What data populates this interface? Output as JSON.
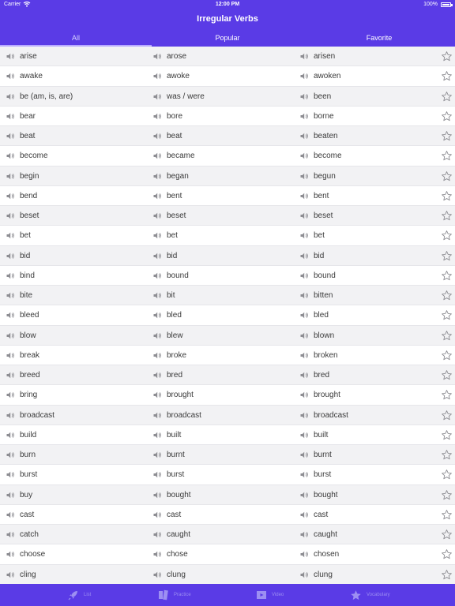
{
  "status_bar": {
    "carrier": "Carrier",
    "time": "12:00 PM",
    "battery": "100%"
  },
  "header": {
    "title": "Irregular Verbs"
  },
  "tabs": [
    {
      "label": "All",
      "active": true
    },
    {
      "label": "Popular",
      "active": false
    },
    {
      "label": "Favorite",
      "active": false
    }
  ],
  "verbs": [
    [
      "arise",
      "arose",
      "arisen"
    ],
    [
      "awake",
      "awoke",
      "awoken"
    ],
    [
      "be (am, is, are)",
      "was / were",
      "been"
    ],
    [
      "bear",
      "bore",
      "borne"
    ],
    [
      "beat",
      "beat",
      "beaten"
    ],
    [
      "become",
      "became",
      "become"
    ],
    [
      "begin",
      "began",
      "begun"
    ],
    [
      "bend",
      "bent",
      "bent"
    ],
    [
      "beset",
      "beset",
      "beset"
    ],
    [
      "bet",
      "bet",
      "bet"
    ],
    [
      "bid",
      "bid",
      "bid"
    ],
    [
      "bind",
      "bound",
      "bound"
    ],
    [
      "bite",
      "bit",
      "bitten"
    ],
    [
      "bleed",
      "bled",
      "bled"
    ],
    [
      "blow",
      "blew",
      "blown"
    ],
    [
      "break",
      "broke",
      "broken"
    ],
    [
      "breed",
      "bred",
      "bred"
    ],
    [
      "bring",
      "brought",
      "brought"
    ],
    [
      "broadcast",
      "broadcast",
      "broadcast"
    ],
    [
      "build",
      "built",
      "built"
    ],
    [
      "burn",
      "burnt",
      "burnt"
    ],
    [
      "burst",
      "burst",
      "burst"
    ],
    [
      "buy",
      "bought",
      "bought"
    ],
    [
      "cast",
      "cast",
      "cast"
    ],
    [
      "catch",
      "caught",
      "caught"
    ],
    [
      "choose",
      "chose",
      "chosen"
    ],
    [
      "cling",
      "clung",
      "clung"
    ]
  ],
  "tabbar": [
    {
      "label": "List",
      "icon": "rocket-icon"
    },
    {
      "label": "Practice",
      "icon": "cards-icon"
    },
    {
      "label": "Video",
      "icon": "video-icon"
    },
    {
      "label": "Vocabulary",
      "icon": "star-icon"
    }
  ],
  "colors": {
    "primary": "#5a3be6",
    "row_alt": "#f2f2f4",
    "text": "#3a3a3a",
    "icon_gray": "#8e8e93"
  }
}
